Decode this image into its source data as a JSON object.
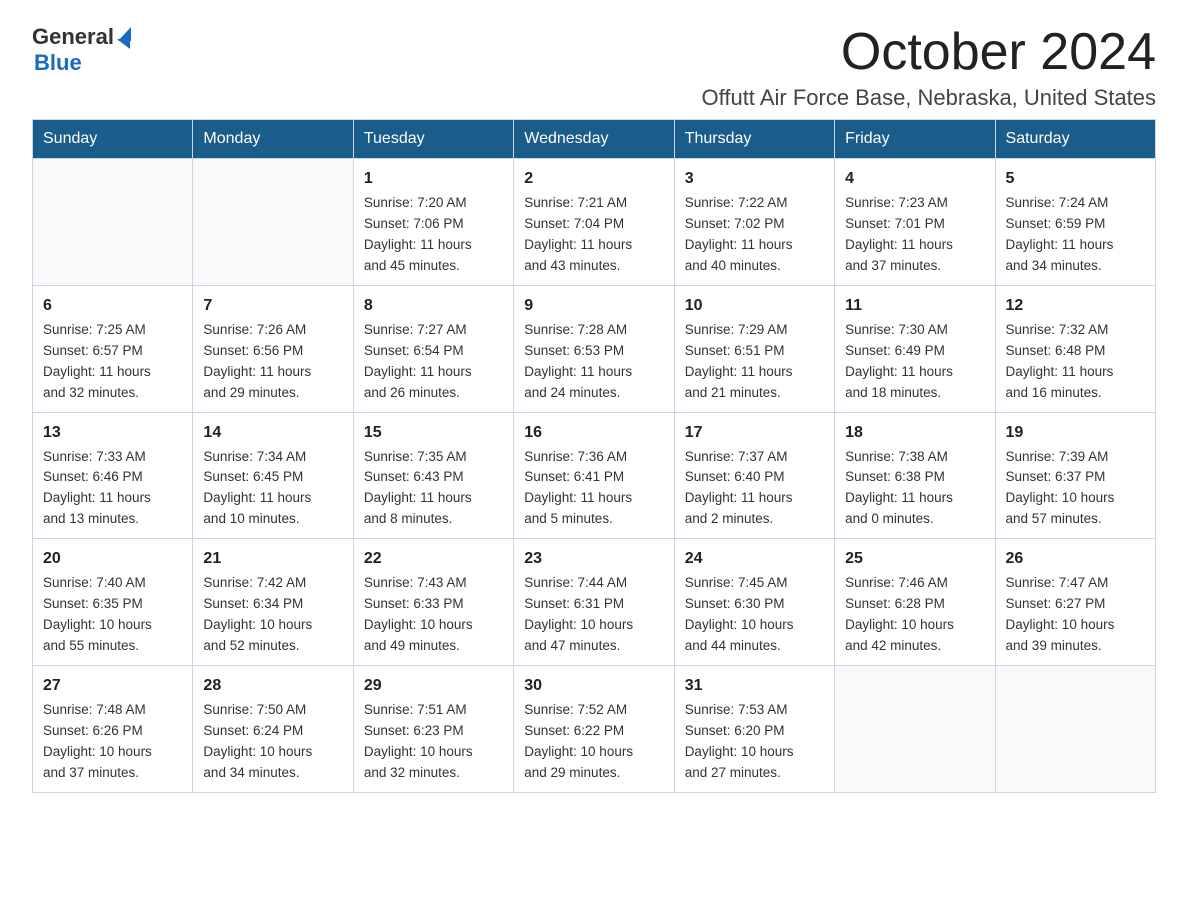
{
  "logo": {
    "general": "General",
    "blue": "Blue",
    "triangle": "▶"
  },
  "header": {
    "month_title": "October 2024",
    "location": "Offutt Air Force Base, Nebraska, United States"
  },
  "days_of_week": [
    "Sunday",
    "Monday",
    "Tuesday",
    "Wednesday",
    "Thursday",
    "Friday",
    "Saturday"
  ],
  "weeks": [
    [
      {
        "day": "",
        "info": ""
      },
      {
        "day": "",
        "info": ""
      },
      {
        "day": "1",
        "info": "Sunrise: 7:20 AM\nSunset: 7:06 PM\nDaylight: 11 hours\nand 45 minutes."
      },
      {
        "day": "2",
        "info": "Sunrise: 7:21 AM\nSunset: 7:04 PM\nDaylight: 11 hours\nand 43 minutes."
      },
      {
        "day": "3",
        "info": "Sunrise: 7:22 AM\nSunset: 7:02 PM\nDaylight: 11 hours\nand 40 minutes."
      },
      {
        "day": "4",
        "info": "Sunrise: 7:23 AM\nSunset: 7:01 PM\nDaylight: 11 hours\nand 37 minutes."
      },
      {
        "day": "5",
        "info": "Sunrise: 7:24 AM\nSunset: 6:59 PM\nDaylight: 11 hours\nand 34 minutes."
      }
    ],
    [
      {
        "day": "6",
        "info": "Sunrise: 7:25 AM\nSunset: 6:57 PM\nDaylight: 11 hours\nand 32 minutes."
      },
      {
        "day": "7",
        "info": "Sunrise: 7:26 AM\nSunset: 6:56 PM\nDaylight: 11 hours\nand 29 minutes."
      },
      {
        "day": "8",
        "info": "Sunrise: 7:27 AM\nSunset: 6:54 PM\nDaylight: 11 hours\nand 26 minutes."
      },
      {
        "day": "9",
        "info": "Sunrise: 7:28 AM\nSunset: 6:53 PM\nDaylight: 11 hours\nand 24 minutes."
      },
      {
        "day": "10",
        "info": "Sunrise: 7:29 AM\nSunset: 6:51 PM\nDaylight: 11 hours\nand 21 minutes."
      },
      {
        "day": "11",
        "info": "Sunrise: 7:30 AM\nSunset: 6:49 PM\nDaylight: 11 hours\nand 18 minutes."
      },
      {
        "day": "12",
        "info": "Sunrise: 7:32 AM\nSunset: 6:48 PM\nDaylight: 11 hours\nand 16 minutes."
      }
    ],
    [
      {
        "day": "13",
        "info": "Sunrise: 7:33 AM\nSunset: 6:46 PM\nDaylight: 11 hours\nand 13 minutes."
      },
      {
        "day": "14",
        "info": "Sunrise: 7:34 AM\nSunset: 6:45 PM\nDaylight: 11 hours\nand 10 minutes."
      },
      {
        "day": "15",
        "info": "Sunrise: 7:35 AM\nSunset: 6:43 PM\nDaylight: 11 hours\nand 8 minutes."
      },
      {
        "day": "16",
        "info": "Sunrise: 7:36 AM\nSunset: 6:41 PM\nDaylight: 11 hours\nand 5 minutes."
      },
      {
        "day": "17",
        "info": "Sunrise: 7:37 AM\nSunset: 6:40 PM\nDaylight: 11 hours\nand 2 minutes."
      },
      {
        "day": "18",
        "info": "Sunrise: 7:38 AM\nSunset: 6:38 PM\nDaylight: 11 hours\nand 0 minutes."
      },
      {
        "day": "19",
        "info": "Sunrise: 7:39 AM\nSunset: 6:37 PM\nDaylight: 10 hours\nand 57 minutes."
      }
    ],
    [
      {
        "day": "20",
        "info": "Sunrise: 7:40 AM\nSunset: 6:35 PM\nDaylight: 10 hours\nand 55 minutes."
      },
      {
        "day": "21",
        "info": "Sunrise: 7:42 AM\nSunset: 6:34 PM\nDaylight: 10 hours\nand 52 minutes."
      },
      {
        "day": "22",
        "info": "Sunrise: 7:43 AM\nSunset: 6:33 PM\nDaylight: 10 hours\nand 49 minutes."
      },
      {
        "day": "23",
        "info": "Sunrise: 7:44 AM\nSunset: 6:31 PM\nDaylight: 10 hours\nand 47 minutes."
      },
      {
        "day": "24",
        "info": "Sunrise: 7:45 AM\nSunset: 6:30 PM\nDaylight: 10 hours\nand 44 minutes."
      },
      {
        "day": "25",
        "info": "Sunrise: 7:46 AM\nSunset: 6:28 PM\nDaylight: 10 hours\nand 42 minutes."
      },
      {
        "day": "26",
        "info": "Sunrise: 7:47 AM\nSunset: 6:27 PM\nDaylight: 10 hours\nand 39 minutes."
      }
    ],
    [
      {
        "day": "27",
        "info": "Sunrise: 7:48 AM\nSunset: 6:26 PM\nDaylight: 10 hours\nand 37 minutes."
      },
      {
        "day": "28",
        "info": "Sunrise: 7:50 AM\nSunset: 6:24 PM\nDaylight: 10 hours\nand 34 minutes."
      },
      {
        "day": "29",
        "info": "Sunrise: 7:51 AM\nSunset: 6:23 PM\nDaylight: 10 hours\nand 32 minutes."
      },
      {
        "day": "30",
        "info": "Sunrise: 7:52 AM\nSunset: 6:22 PM\nDaylight: 10 hours\nand 29 minutes."
      },
      {
        "day": "31",
        "info": "Sunrise: 7:53 AM\nSunset: 6:20 PM\nDaylight: 10 hours\nand 27 minutes."
      },
      {
        "day": "",
        "info": ""
      },
      {
        "day": "",
        "info": ""
      }
    ]
  ]
}
